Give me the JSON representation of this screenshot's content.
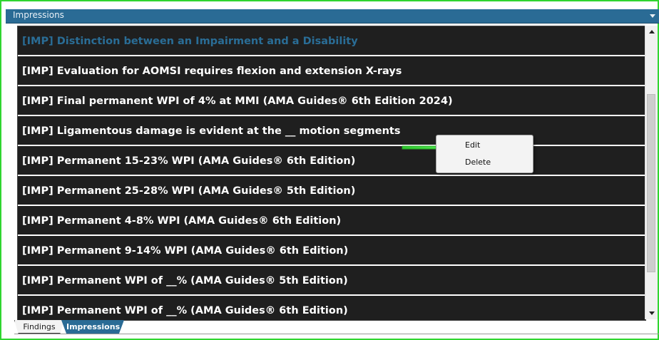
{
  "panel": {
    "title": "Impressions"
  },
  "list": {
    "items": [
      {
        "label": "[IMP] Distinction between an Impairment and a Disability",
        "highlighted": true
      },
      {
        "label": "[IMP] Evaluation for AOMSI requires flexion and extension X-rays",
        "highlighted": false
      },
      {
        "label": "[IMP] Final permanent WPI of 4% at MMI (AMA Guides® 6th Edition 2024)",
        "highlighted": false
      },
      {
        "label": "[IMP] Ligamentous damage is evident at the __ motion segments",
        "highlighted": false
      },
      {
        "label": "[IMP] Permanent 15-23% WPI (AMA Guides® 6th Edition)",
        "highlighted": false
      },
      {
        "label": "[IMP] Permanent 25-28% WPI (AMA Guides® 5th Edition)",
        "highlighted": false
      },
      {
        "label": "[IMP] Permanent 4-8% WPI (AMA Guides® 6th Edition)",
        "highlighted": false
      },
      {
        "label": "[IMP] Permanent 9-14% WPI (AMA Guides® 6th Edition)",
        "highlighted": false
      },
      {
        "label": "[IMP] Permanent WPI of __% (AMA Guides® 5th Edition)",
        "highlighted": false
      },
      {
        "label": "[IMP] Permanent WPI of __% (AMA Guides® 6th Edition)",
        "highlighted": false
      }
    ]
  },
  "tabs": [
    {
      "label": "Findings",
      "active": false
    },
    {
      "label": "Impressions",
      "active": true
    }
  ],
  "context_menu": {
    "items": [
      {
        "label": "Edit"
      },
      {
        "label": "Delete"
      }
    ]
  },
  "colors": {
    "frame_border": "#2fd52f",
    "header_bg": "#2a6b95",
    "row_bg": "#1f1f1f",
    "highlight_text": "#2a6d96",
    "pointer_arrow": "#3dde3d"
  },
  "icons": {
    "scroll_up": "arrow-up-icon",
    "scroll_down": "arrow-down-icon",
    "collapse": "caret-down-icon",
    "annotation": "green-arrow-pointer"
  }
}
